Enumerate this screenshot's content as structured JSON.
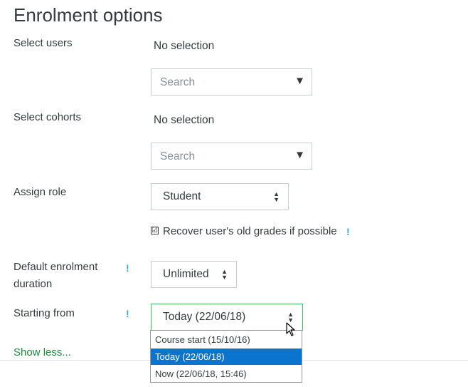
{
  "page_title": "Enrolment options",
  "select_users": {
    "label": "Select users",
    "value": "No selection",
    "search_placeholder": "Search"
  },
  "select_cohorts": {
    "label": "Select cohorts",
    "value": "No selection",
    "search_placeholder": "Search"
  },
  "assign_role": {
    "label": "Assign role",
    "selected": "Student"
  },
  "recover_grades": {
    "label": "Recover user's old grades if possible",
    "checked": true,
    "check_glyph": "☑"
  },
  "default_duration": {
    "label_line1": "Default enrolment",
    "label_line2": "duration",
    "selected": "Unlimited"
  },
  "starting_from": {
    "label": "Starting from",
    "selected": "Today (22/06/18)",
    "options": [
      "Course start (15/10/16)",
      "Today (22/06/18)",
      "Now (22/06/18, 15:46)"
    ],
    "selected_option_color": "#0a74cf",
    "focus_border_color": "#3fbf5f"
  },
  "help_glyph": "!",
  "show_less_link": "Show less...",
  "colors": {
    "link": "#1f8a3c",
    "help_icon": "#40a9d8"
  }
}
